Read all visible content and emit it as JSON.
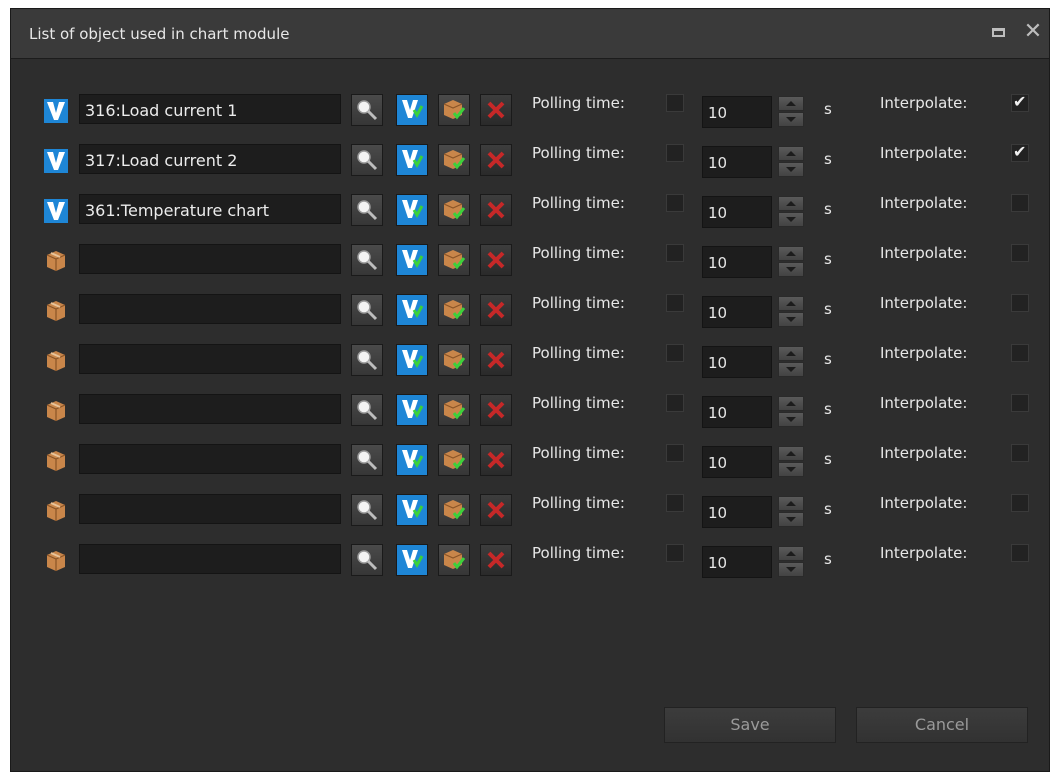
{
  "window": {
    "title": "List of object used in chart module",
    "maximize_icon": "maximize-icon",
    "close_icon": "close-icon"
  },
  "labels": {
    "polling_time": "Polling time:",
    "unit": "s",
    "interpolate": "Interpolate:"
  },
  "rows": [
    {
      "name": "316:Load current 1",
      "icon": "v-object-icon",
      "polling_enabled": false,
      "polling_value": "10",
      "interpolate": true
    },
    {
      "name": "317:Load current 2",
      "icon": "v-object-icon",
      "polling_enabled": false,
      "polling_value": "10",
      "interpolate": true
    },
    {
      "name": "361:Temperature chart",
      "icon": "v-object-icon",
      "polling_enabled": false,
      "polling_value": "10",
      "interpolate": false
    },
    {
      "name": "",
      "icon": "box-icon",
      "polling_enabled": false,
      "polling_value": "10",
      "interpolate": false
    },
    {
      "name": "",
      "icon": "box-icon",
      "polling_enabled": false,
      "polling_value": "10",
      "interpolate": false
    },
    {
      "name": "",
      "icon": "box-icon",
      "polling_enabled": false,
      "polling_value": "10",
      "interpolate": false
    },
    {
      "name": "",
      "icon": "box-icon",
      "polling_enabled": false,
      "polling_value": "10",
      "interpolate": false
    },
    {
      "name": "",
      "icon": "box-icon",
      "polling_enabled": false,
      "polling_value": "10",
      "interpolate": false
    },
    {
      "name": "",
      "icon": "box-icon",
      "polling_enabled": false,
      "polling_value": "10",
      "interpolate": false
    },
    {
      "name": "",
      "icon": "box-icon",
      "polling_enabled": false,
      "polling_value": "10",
      "interpolate": false
    }
  ],
  "row_buttons": {
    "search_icon": "search-icon",
    "select_icon": "select-object-icon",
    "box_icon": "box-check-icon",
    "remove_icon": "remove-icon"
  },
  "footer": {
    "save_label": "Save",
    "cancel_label": "Cancel"
  },
  "colors": {
    "background": "#2d2d2d",
    "titlebar": "#3a3a3a",
    "accent_blue": "#1e86d6",
    "remove_red": "#c62828"
  }
}
